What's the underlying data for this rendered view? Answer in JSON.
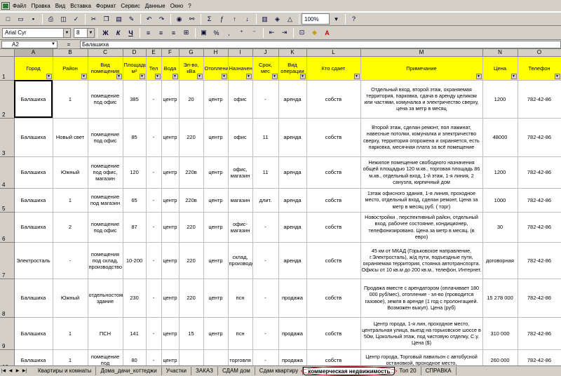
{
  "menu": [
    "Файл",
    "Правка",
    "Вид",
    "Вставка",
    "Формат",
    "Сервис",
    "Данные",
    "Окно",
    "?"
  ],
  "toolbar": {
    "zoom": "100%"
  },
  "format": {
    "font": "Arial Cyr",
    "size": "8",
    "bold": "Ж",
    "italic": "К",
    "underline": "Ч",
    "currency": "%",
    "thousands": ","
  },
  "formula": {
    "cell": "A2",
    "fx": "=",
    "value": "Балашиха"
  },
  "columns": [
    "A",
    "B",
    "C",
    "D",
    "E",
    "F",
    "G",
    "H",
    "I",
    "J",
    "K",
    "L",
    "M",
    "N",
    "O"
  ],
  "headers": [
    "Город",
    "Район",
    "Вид помещения",
    "Площадь, м²",
    "Тел",
    "Вода",
    "Эл-во, кВа",
    "Отопление",
    "Назначение",
    "Срок, мес",
    "Вид операции",
    "Кто сдает",
    "Примечание",
    "Цена",
    "Телефон"
  ],
  "rows": [
    {
      "n": "2",
      "c": [
        "Балашиха",
        "1",
        "помещение под офис",
        "385",
        "-",
        "центр",
        "20",
        "центр",
        "офис",
        "-",
        "аренда",
        "собств",
        "Отдельный вход, второй этаж, охраняемая территория, парковка, сдача в аренду целиком или частями, комуналка и электричество сверху, цена за метр в месяц",
        "1200",
        "782-42-86"
      ]
    },
    {
      "n": "3",
      "c": [
        "Балашиха",
        "Новый свет",
        "помещение под офис",
        "85",
        "-",
        "центр",
        "220",
        "центр",
        "офис",
        "11",
        "аренда",
        "собств",
        "Второй этаж, сделан ремонт, пол ламинат, навесные потолки, комуналка и электричество сверху, территория огорожена и охраняется, есть парковка, месячная плата за всё помещение",
        "48000",
        "782-42-86"
      ]
    },
    {
      "n": "4",
      "c": [
        "Балашиха",
        "Южный",
        "помещение под офис, магазин",
        "120",
        "-",
        "центр",
        "220в",
        "центр",
        "офис, магазин",
        "11",
        "аренда",
        "собств",
        "Нежилое помещение свободного назначения общей площадью 120 м.кв., торговая площадь 86 м.кв., отдельный вход, 1-й этаж, 1-я линия, 2 санузла, кирпичный дом",
        "1200",
        "782-42-86"
      ]
    },
    {
      "n": "5",
      "c": [
        "Балашиха",
        "1",
        "помещение под магазин",
        "65",
        "-",
        "центр",
        "220в",
        "центр",
        "магазин",
        "длит.",
        "аренда",
        "собств",
        "1этаж офисного здания, 1-я линия, проходное место, отдельный вход, сделан ремонт, Цена за метр в месяц руб. ( торг)",
        "1000",
        "782-42-86"
      ]
    },
    {
      "n": "6",
      "c": [
        "Балашиха",
        "2",
        "помещение под офис",
        "87",
        "-",
        "центр",
        "220",
        "центр",
        "офис-магазин",
        "-",
        "аренда",
        "собств",
        "Новостройки , перспективный район, отдельный вход, рабочее состояние, кондиционер, телефонизировано. Цена за метр в месяц. (в евро)",
        "30",
        "782-42-86"
      ]
    },
    {
      "n": "7",
      "c": [
        "Электросталь",
        "-",
        "помещения под склад, производство",
        "10-200",
        "-",
        "центр",
        "220",
        "центр",
        "склад, производство",
        "-",
        "аренда",
        "собств",
        "45 км от МКАД (Горьковское направление, г.Электросталь), ж/д пути, подъездные пути, охраняемая территория, стоянка автотранспорта. Офисы от 10 кв.м до 200 кв.м., телефон, Интернет.",
        "договорная",
        "782-42-86"
      ]
    },
    {
      "n": "8",
      "c": [
        "Балашиха",
        "Южный",
        "отдельностоящее здание",
        "230",
        "-",
        "центр",
        "220",
        "центр",
        "псн",
        "-",
        "продажа",
        "собств",
        "Продажа вместе с арендатором (оплачивает 180 000 руб/мес), отопление - эл-во (проводится газовое), земля в аренде (1 год с пролонгацией. Возможен выкуп). Цена (руб)",
        "15 278 000",
        "782-42-86"
      ]
    },
    {
      "n": "9",
      "c": [
        "Балашиха",
        "1",
        "ПСН",
        "141",
        "-",
        "центр",
        "15",
        "центр",
        "псн",
        "-",
        "продажа",
        "собств",
        "Центр города, 1-я лин, проходное место, центральная улица, выезд на горьковское шоссе в 50м, Цокольный этаж, под чистовую отделку, С.у. Цена ($)",
        "310 000",
        "782-42-86"
      ]
    },
    {
      "n": "10",
      "c": [
        "Балашиха",
        "1",
        "помещение под",
        "80",
        "-",
        "центр",
        "",
        "",
        "торговля",
        "-",
        "продажа",
        "собств",
        "Центр города, Торговый павильон с автобусной остановкой, проходное место,",
        "260 000",
        "782-42-86"
      ]
    }
  ],
  "tabs": [
    "Квартиры и комнаты",
    "Дома_дачи_коттеджи",
    "Участки",
    "ЗАКАЗ",
    "СДАМ дом",
    "Сдам квартиру",
    "коммерческая недвижимость",
    "Топ 20",
    "СПРАВКА"
  ],
  "active_tab": "коммерческая недвижимость"
}
